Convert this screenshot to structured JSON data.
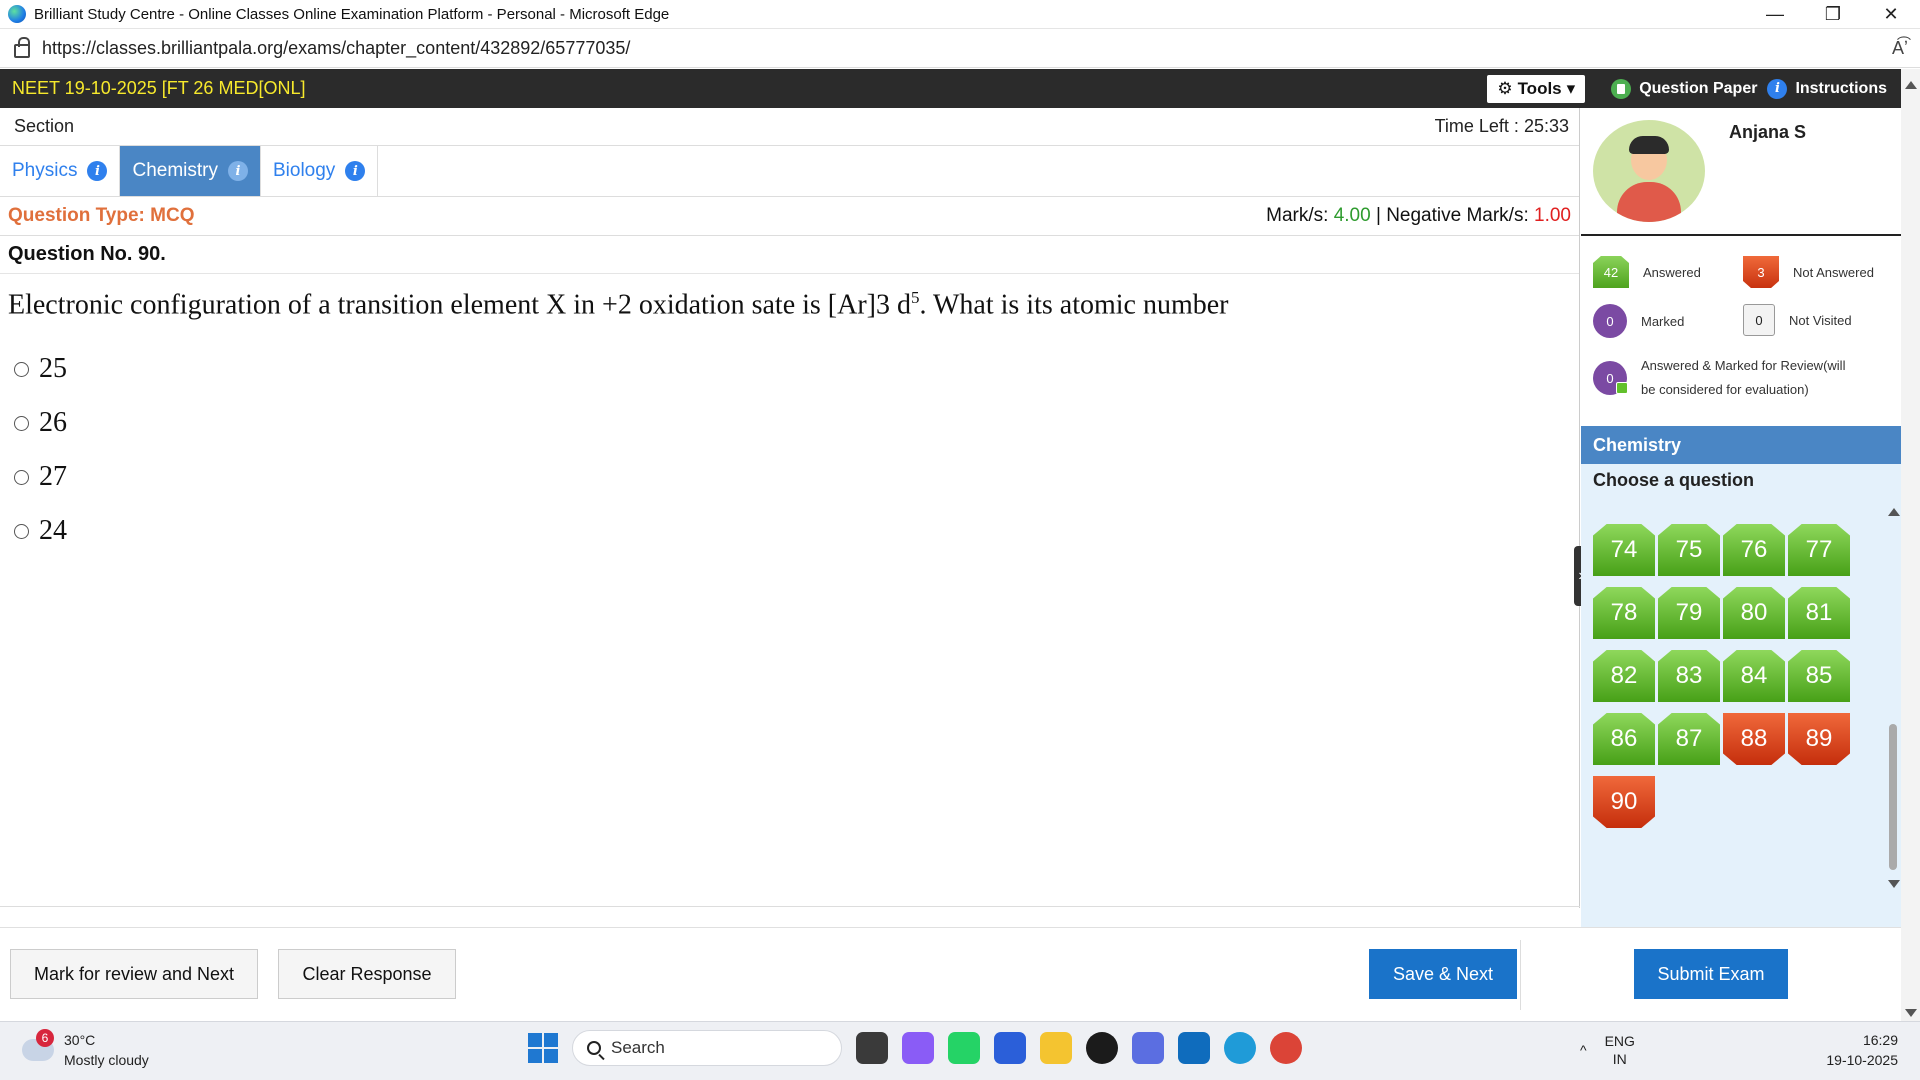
{
  "browser": {
    "window_title": "Brilliant Study Centre - Online Classes Online Examination Platform - Personal - Microsoft Edge",
    "url": "https://classes.brilliantpala.org/exams/chapter_content/432892/65777035/",
    "readaloud_glyph": "A͡ʼ",
    "minimize": "—",
    "restore": "❐",
    "close": "✕"
  },
  "exam": {
    "title": "NEET 19-10-2025 [FT 26 MED[ONL]",
    "tools_label": "Tools",
    "tools_glyph": "⚙",
    "caret": "▾",
    "question_paper_label": "Question Paper",
    "instructions_label": "Instructions",
    "info_glyph": "i"
  },
  "section": {
    "label": "Section",
    "time_left_label": "Time Left :",
    "time_left_value": "25:33",
    "tabs": [
      {
        "label": "Physics",
        "active": false
      },
      {
        "label": "Chemistry",
        "active": true
      },
      {
        "label": "Biology",
        "active": false
      }
    ]
  },
  "question": {
    "type_label": "Question Type: MCQ",
    "marks_label": "Mark/s:",
    "marks_value": "4.00",
    "separator": "|",
    "negative_label": "Negative Mark/s:",
    "negative_value": "1.00",
    "number_label": "Question No. 90.",
    "text_before": "Electronic configuration of a transition element X in +2 oxidation sate is [Ar]3 d",
    "superscript": "5",
    "text_after": ". What is its atomic number",
    "options": [
      "25",
      "26",
      "27",
      "24"
    ]
  },
  "footer": {
    "mark_review_label": "Mark for review and Next",
    "clear_label": "Clear Response",
    "save_next_label": "Save & Next",
    "submit_label": "Submit Exam"
  },
  "profile": {
    "name": "Anjana S"
  },
  "legend": {
    "answered_count": "42",
    "answered_label": "Answered",
    "not_answered_count": "3",
    "not_answered_label": "Not Answered",
    "marked_count": "0",
    "marked_label": "Marked",
    "not_visited_count": "0",
    "not_visited_label": "Not Visited",
    "answered_marked_count": "0",
    "answered_marked_label": "Answered & Marked for Review(will be considered for evaluation)"
  },
  "palette": {
    "section_name": "Chemistry",
    "choose_label": "Choose a question",
    "collapse_glyph": "›",
    "questions": [
      {
        "n": "74",
        "status": "answered"
      },
      {
        "n": "75",
        "status": "answered"
      },
      {
        "n": "76",
        "status": "answered"
      },
      {
        "n": "77",
        "status": "answered"
      },
      {
        "n": "78",
        "status": "answered"
      },
      {
        "n": "79",
        "status": "answered"
      },
      {
        "n": "80",
        "status": "answered"
      },
      {
        "n": "81",
        "status": "answered"
      },
      {
        "n": "82",
        "status": "answered"
      },
      {
        "n": "83",
        "status": "answered"
      },
      {
        "n": "84",
        "status": "answered"
      },
      {
        "n": "85",
        "status": "answered"
      },
      {
        "n": "86",
        "status": "answered"
      },
      {
        "n": "87",
        "status": "answered"
      },
      {
        "n": "88",
        "status": "not-answered"
      },
      {
        "n": "89",
        "status": "not-answered"
      },
      {
        "n": "90",
        "status": "not-answered"
      }
    ]
  },
  "taskbar": {
    "weather_badge": "6",
    "temperature": "30°C",
    "weather_text": "Mostly cloudy",
    "search_label": "Search",
    "lang_top": "ENG",
    "lang_bottom": "IN",
    "tray_caret": "^",
    "time": "16:29",
    "date": "19-10-2025",
    "colors": {
      "app_copilot": "#8a5cf6",
      "app_whatsapp": "#25d366",
      "app_store": "#2b5fd9",
      "app_explorer": "#f4c430",
      "app_dell": "#1b1b1b",
      "app_m365": "#5b6ee1",
      "app_outlook": "#0f6cbd",
      "app_edge": "#1f9bd8",
      "app_chrome": "#db4437"
    }
  },
  "colors": {
    "answered": "#4ea31e",
    "not_answered": "#c8320f",
    "marked": "#7b4aa3",
    "accent": "#4a86c5",
    "exam_title": "#f7e92c"
  }
}
